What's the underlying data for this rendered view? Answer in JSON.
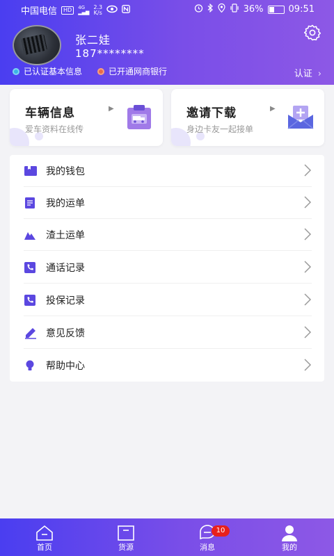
{
  "statusbar": {
    "carrier": "中国电信",
    "hd": "HD",
    "signal": "4G",
    "net_speed_value": "2.3",
    "net_speed_unit": "K/s",
    "battery_percent": "36%",
    "battery_level": 0.36,
    "time": "09:51"
  },
  "profile": {
    "name": "张二娃",
    "phone": "187********",
    "badges": [
      {
        "label": "已认证基本信息",
        "color": "#3bb4e6"
      },
      {
        "label": "已开通网商银行",
        "color": "#e86a4a"
      }
    ],
    "verify_label": "认证",
    "verify_chevron": "›"
  },
  "cards": [
    {
      "title": "车辆信息",
      "subtitle": "爱车资料在线传",
      "arrow": "▶",
      "icon": "vehicle-document-icon"
    },
    {
      "title": "邀请下载",
      "subtitle": "身边卡友一起接单",
      "arrow": "▶",
      "icon": "invite-envelope-icon"
    }
  ],
  "menu": [
    {
      "label": "我的钱包",
      "icon": "wallet-icon"
    },
    {
      "label": "我的运单",
      "icon": "waybill-icon"
    },
    {
      "label": "渣土运单",
      "icon": "muck-waybill-icon"
    },
    {
      "label": "通话记录",
      "icon": "call-record-icon"
    },
    {
      "label": "投保记录",
      "icon": "insurance-record-icon"
    },
    {
      "label": "意见反馈",
      "icon": "feedback-icon"
    },
    {
      "label": "帮助中心",
      "icon": "help-center-icon"
    }
  ],
  "tabbar": {
    "tabs": [
      {
        "label": "首页",
        "icon": "home-icon"
      },
      {
        "label": "货源",
        "icon": "goods-source-icon"
      },
      {
        "label": "消息",
        "icon": "message-icon",
        "badge": "10"
      },
      {
        "label": "我的",
        "icon": "profile-icon",
        "active": true
      }
    ]
  },
  "colors": {
    "gradient_start": "#4a3ef0",
    "gradient_end": "#8d58e6",
    "accent": "#5b47e0",
    "badge_red": "#e8201c"
  }
}
